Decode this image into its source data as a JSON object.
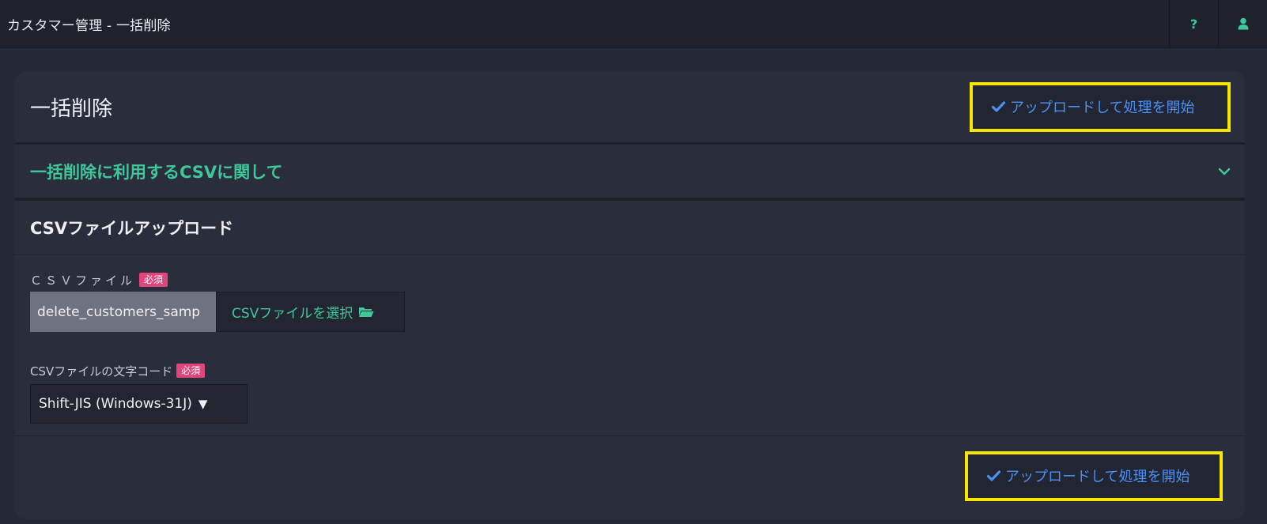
{
  "topbar": {
    "title": "カスタマー管理 - 一括削除",
    "help_icon": "question-icon",
    "user_icon": "user-icon",
    "help_label": "?"
  },
  "card": {
    "title": "一括削除",
    "upload_button_label": "アップロードして処理を開始",
    "upload_icon": "check-icon"
  },
  "accordion": {
    "title": "一括削除に利用するCSVに関して",
    "icon": "chevron-down-icon"
  },
  "section": {
    "title": "CSVファイルアップロード"
  },
  "fields": {
    "csv_file": {
      "label": "ＣＳＶファイル",
      "required_badge": "必須",
      "value": "delete_customers_samp",
      "select_button_label": "CSVファイルを選択",
      "select_icon": "folder-open-icon"
    },
    "encoding": {
      "label": "CSVファイルの文字コード",
      "required_badge": "必須",
      "selected": "Shift-JIS (Windows-31J)",
      "arrow": "▼"
    }
  },
  "footer": {
    "upload_button_label": "アップロードして処理を開始"
  },
  "colors": {
    "accent_green": "#3fc79a",
    "accent_blue": "#4d8ff0",
    "highlight_yellow": "#f6e600",
    "required_pink": "#e0457b"
  }
}
